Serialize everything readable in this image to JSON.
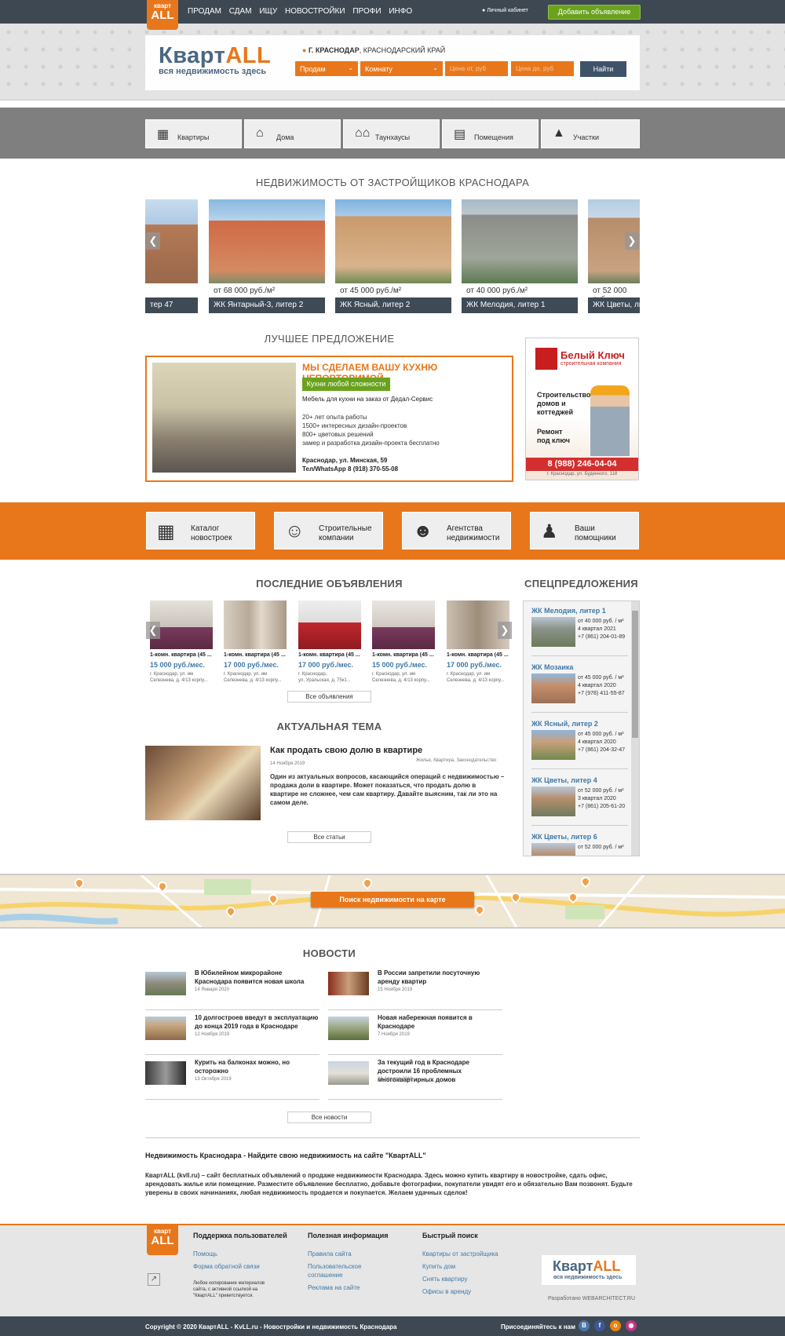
{
  "topbar": {
    "logo_line1": "кварт",
    "logo_line2": "ALL",
    "nav": [
      "ПРОДАМ",
      "СДАМ",
      "ИЩУ",
      "НОВОСТРОЙКИ",
      "ПРОФИ",
      "ИНФО"
    ],
    "cabinet": "Личный кабинет",
    "add_button": "Добавить объявление"
  },
  "header": {
    "logo_part1": "Кварт",
    "logo_part2": "ALL",
    "tagline": "вся недвижимость здесь",
    "city_bold": "Г. КРАСНОДАР",
    "city_rest": ", КРАСНОДАРСКИЙ КРАЙ",
    "deal_select": "Продам",
    "type_select": "Комнату",
    "price_from_placeholder": "Цена от, руб",
    "price_to_placeholder": "Цена до, руб",
    "find_button": "Найти"
  },
  "categories": [
    "Квартиры",
    "Дома",
    "Таунхаусы",
    "Помещения",
    "Участки"
  ],
  "developers": {
    "title": "НЕДВИЖИМОСТЬ ОТ ЗАСТРОЙЩИКОВ КРАСНОДАРА",
    "items": [
      {
        "name": "тер 47",
        "price": ""
      },
      {
        "name": "ЖК Янтарный-3, литер 2",
        "price": "от 68 000 руб./м²"
      },
      {
        "name": "ЖК Ясный, литер 2",
        "price": "от 45 000 руб./м²"
      },
      {
        "name": "ЖК Мелодия, литер 1",
        "price": "от 40 000 руб./м²"
      },
      {
        "name": "ЖК Цветы, лит",
        "price": "от 52 000 руб"
      }
    ]
  },
  "best_offer": {
    "title": "ЛУЧШЕЕ ПРЕДЛОЖЕНИЕ",
    "heading": "МЫ СДЕЛАЕМ ВАШУ КУХНЮ НЕПОВТОРИМОЙ",
    "badge": "Кухни любой сложности",
    "subtitle": "Мебель для кухни на заказ от Дедал-Сервис",
    "list": [
      "20+ лет опыта работы",
      "1500+ интересных дизайн-проектов",
      "800+ цветовых решений",
      "замер и разработка дизайн-проекта бесплатно"
    ],
    "address": "Краснодар, ул. Минская, 59",
    "phone": "Тел/WhatsApp  8 (918) 370-55-08"
  },
  "banner": {
    "brand": "Белый Ключ",
    "brand_sub": "строительная компания",
    "text1": [
      "Строительство",
      "домов и",
      "коттеджей"
    ],
    "text2": [
      "Ремонт",
      "под ключ"
    ],
    "phone": "8 (988) 246-04-04",
    "address": "г. Краснодар, ул. Буденного, 118"
  },
  "orange_categories": [
    {
      "line1": "Каталог",
      "line2": "новостроек"
    },
    {
      "line1": "Строительные",
      "line2": "компании"
    },
    {
      "line1": "Агентства",
      "line2": "недвижимости"
    },
    {
      "line1": "Ваши",
      "line2": "помощники"
    }
  ],
  "last_ads": {
    "title": "ПОСЛЕДНИЕ ОБЪЯВЛЕНИЯ",
    "items": [
      {
        "title": "1-комн. квартира (45 ...",
        "price": "15 000 руб./мес.",
        "addr1": "г. Краснодар, ул. им",
        "addr2": "Селезнева, д. 4/13 корпу..."
      },
      {
        "title": "1-комн. квартира (45 ...",
        "price": "17 000 руб./мес.",
        "addr1": "г. Краснодар, ул. им",
        "addr2": "Селезнева, д. 4/13 корпу..."
      },
      {
        "title": "1-комн. квартира (45 ...",
        "price": "17 000 руб./мес.",
        "addr1": "г. Краснодар,",
        "addr2": "ул. Уральская, д. 75к1..."
      },
      {
        "title": "1-комн. квартира (45 ...",
        "price": "15 000 руб./мес.",
        "addr1": "г. Краснодар, ул. им",
        "addr2": "Селезнева, д. 4/13 корпу..."
      },
      {
        "title": "1-комн. квартира (45 ...",
        "price": "17 000 руб./мес.",
        "addr1": "г. Краснодар, ул. им",
        "addr2": "Селезнева, д. 4/13 корпу..."
      }
    ],
    "all_button": "Все объявления"
  },
  "topic": {
    "title": "АКТУАЛЬНАЯ ТЕМА",
    "article_title": "Как продать свою долю в квартире",
    "date": "14 Ноября 2019",
    "tags": "Жилье, Квартира, Законодательство",
    "text": "Один из актуальных вопросов, касающийся операций с недвижимостью – продажа доли в квартире. Может показаться, что продать долю в квартире не сложнее, чем сам квартиру. Давайте выясним, так ли это на самом деле.",
    "all_button": "Все статьи"
  },
  "special": {
    "title": "СПЕЦПРЕДЛОЖЕНИЯ",
    "items": [
      {
        "name": "ЖК Мелодия, литер 1",
        "price": "от 40 000 руб. / м²",
        "date": "4 квартал 2021",
        "phone": "+7 (861) 204-01-89"
      },
      {
        "name": "ЖК Мозаика",
        "price": "от 45 000 руб. / м²",
        "date": "4 квартал 2020",
        "phone": "+7 (978) 411-55-87"
      },
      {
        "name": "ЖК Ясный, литер 2",
        "price": "от 45 000 руб. / м²",
        "date": "4 квартал 2020",
        "phone": "+7 (861) 204-32-47"
      },
      {
        "name": "ЖК Цветы, литер 4",
        "price": "от 52 000 руб. / м²",
        "date": "3 квартал 2020",
        "phone": "+7 (861) 205-61-20"
      },
      {
        "name": "ЖК Цветы, литер 6",
        "price": "от 52 000 руб. / м²",
        "date": "",
        "phone": ""
      }
    ]
  },
  "map_button": "Поиск недвижимости на карте",
  "news": {
    "title": "НОВОСТИ",
    "items": [
      {
        "title": "В Юбилейном микрорайоне Краснодара появится новая школа",
        "date": "14 Января 2020"
      },
      {
        "title": "В России запретили посуточную аренду квартир",
        "date": "15 Ноября 2019"
      },
      {
        "title": "10 долгостроев введут в эксплуатацию до конца 2019 года в Краснодаре",
        "date": "12 Ноября 2019"
      },
      {
        "title": "Новая набережная появится в Краснодаре",
        "date": "7 Ноября 2019"
      },
      {
        "title": "Курить на балконах можно, но осторожно",
        "date": "13 Октября 2019"
      },
      {
        "title": "За текущий год в Краснодаре достроили 16 проблемных многоквартирных домов",
        "date": "26 Августа 2019"
      }
    ],
    "all_button": "Все новости"
  },
  "seo": {
    "title": "Недвижимость Краснодара - Найдите свою недвижимость на сайте \"КвартALL\"",
    "text": "КвартALL (kvll.ru) – сайт бесплатных объявлений о продаже недвижимости Краснодара. Здесь можно купить квартиру в новостройке, сдать офис, арендовать жилье или помещение. Разместите объявление бесплатно, добавьте фотографии, покупатели увидят его и обязательно Вам позвонят. Будьте уверены в своих начинаниях, любая недвижимость продается и покупается. Желаем удачных сделок!"
  },
  "footer": {
    "col1_title": "Поддержка пользователей",
    "col1_items": [
      "Помощь",
      "Форма обратной связи"
    ],
    "col2_title": "Полезная информация",
    "col2_items": [
      "Правила сайта",
      "Пользовательское соглашение",
      "Реклама на сайте"
    ],
    "col3_title": "Быстрый поиск",
    "col3_items": [
      "Квартиры от застройщика",
      "Купить дом",
      "Снять квартиру",
      "Офисы в аренду"
    ],
    "copy_note": "Любое копирование материалов сайта, с активной ссылкой на \"КвартALL\" приветствуется.",
    "developer": "Разработано  WEBARCHITECT.RU",
    "copyright": "Copyright © 2020 КвартALL - KvLL.ru - Новостройки и недвижимость Краснодара",
    "join": "Присоединяйтесь к нам"
  },
  "colors": {
    "accent": "#e8771b",
    "dark": "#3d4852",
    "green": "#6aa21e",
    "link": "#3f79a8"
  }
}
